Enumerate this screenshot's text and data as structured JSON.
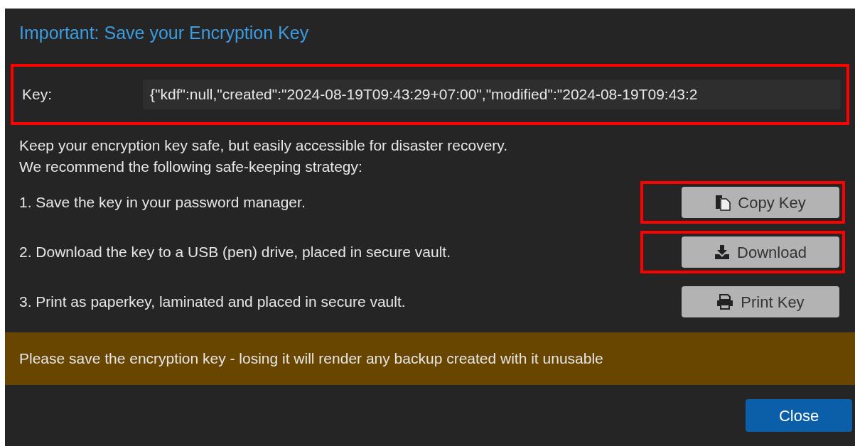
{
  "dialog": {
    "title": "Important: Save your Encryption Key"
  },
  "key_row": {
    "label": "Key:",
    "value": "{\"kdf\":null,\"created\":\"2024-08-19T09:43:29+07:00\",\"modified\":\"2024-08-19T09:43:2",
    "highlighted": true
  },
  "intro": [
    "Keep your encryption key safe, but easily accessible for disaster recovery.",
    "We recommend the following safe-keeping strategy:"
  ],
  "steps": [
    {
      "text": "1. Save the key in your password manager.",
      "button": "Copy Key",
      "kind": "copy",
      "highlighted": true
    },
    {
      "text": "2. Download the key to a USB (pen) drive, placed in secure vault.",
      "button": "Download",
      "kind": "download",
      "highlighted": true
    },
    {
      "text": "3. Print as paperkey, laminated and placed in secure vault.",
      "button": "Print Key",
      "kind": "print",
      "highlighted": false
    }
  ],
  "warning": "Please save the encryption key - losing it will render any backup created with it unusable",
  "buttons": [
    "Close"
  ]
}
